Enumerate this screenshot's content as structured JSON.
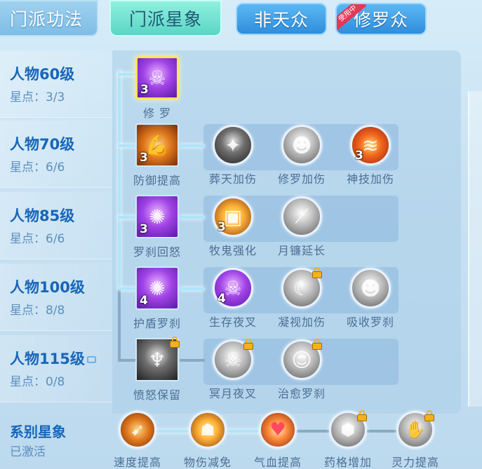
{
  "tabs": [
    {
      "label": "门派功法"
    },
    {
      "label": "门派星象"
    },
    {
      "label": "非天众"
    },
    {
      "label": "修罗众",
      "badge": "使用中"
    }
  ],
  "levels": [
    {
      "name": "人物60级",
      "stars": "星点：3/3"
    },
    {
      "name": "人物70级",
      "stars": "星点：6/6"
    },
    {
      "name": "人物85级",
      "stars": "星点：6/6"
    },
    {
      "name": "人物100级",
      "stars": "星点：8/8"
    },
    {
      "name": "人物115级",
      "stars": "星点：0/8",
      "locked": true
    }
  ],
  "rows": [
    {
      "nodes": [
        {
          "label": "修 罗",
          "count": "3",
          "icon": "asura-icon",
          "color": "#8a3bd4",
          "selected": true
        }
      ]
    },
    {
      "nodes": [
        {
          "label": "防御提高",
          "count": "3",
          "icon": "strong-arm-icon"
        },
        {
          "label": "葬天加伤",
          "count": "",
          "icon": "slash-icon"
        },
        {
          "label": "修罗加伤",
          "count": "",
          "icon": "asura-face-icon"
        },
        {
          "label": "神技加伤",
          "count": "3",
          "icon": "claw-icon"
        }
      ]
    },
    {
      "nodes": [
        {
          "label": "罗刹回怒",
          "count": "3",
          "icon": "rakshasa-icon"
        },
        {
          "label": "牧鬼强化",
          "count": "3",
          "icon": "chest-icon"
        },
        {
          "label": "月镰延长",
          "count": "",
          "icon": "blade-icon"
        }
      ]
    },
    {
      "nodes": [
        {
          "label": "护盾罗刹",
          "count": "4",
          "icon": "shield-rakshasa-icon"
        },
        {
          "label": "生存夜叉",
          "count": "4",
          "icon": "yaksha-icon"
        },
        {
          "label": "凝视加伤",
          "count": "",
          "icon": "gaze-icon",
          "locked": true
        },
        {
          "label": "吸收罗刹",
          "count": "",
          "icon": "absorb-icon"
        }
      ]
    },
    {
      "nodes": [
        {
          "label": "愤怒保留",
          "count": "",
          "icon": "demon-icon",
          "locked": true
        },
        {
          "label": "冥月夜叉",
          "count": "",
          "icon": "dark-yaksha-icon",
          "locked": true
        },
        {
          "label": "治愈罗刹",
          "count": "",
          "icon": "heal-rakshasa-icon",
          "locked": true
        }
      ]
    }
  ],
  "bottom": {
    "title": "系别星象",
    "state": "已激活",
    "items": [
      {
        "label": "速度提高",
        "icon": "speed-icon"
      },
      {
        "label": "物伤减免",
        "icon": "person-icon"
      },
      {
        "label": "气血提高",
        "icon": "heart-icon"
      },
      {
        "label": "药格增加",
        "icon": "herb-icon",
        "locked": true
      },
      {
        "label": "灵力提高",
        "icon": "spirit-hand-icon",
        "locked": true
      }
    ]
  }
}
